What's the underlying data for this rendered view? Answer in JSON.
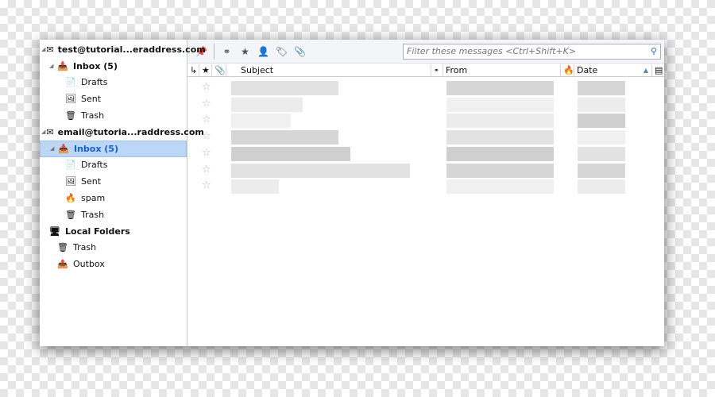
{
  "folders": [
    {
      "label": "test@tutorial...eraddress.com",
      "type": "account",
      "icon": "account-icon",
      "twisty": true
    },
    {
      "label": "Inbox (5)",
      "type": "inbox",
      "icon": "inbox-icon",
      "twisty": true,
      "indent": 1
    },
    {
      "label": "Drafts",
      "icon": "drafts-icon",
      "indent": 2
    },
    {
      "label": "Sent",
      "icon": "sent-icon",
      "indent": 2
    },
    {
      "label": "Trash",
      "icon": "trash-icon",
      "indent": 2
    },
    {
      "label": "email@tutoria...raddress.com",
      "type": "account",
      "icon": "account-icon",
      "twisty": true
    },
    {
      "label": "Inbox (5)",
      "type": "inbox",
      "icon": "inbox-icon",
      "twisty": true,
      "indent": 1,
      "selected": true
    },
    {
      "label": "Drafts",
      "icon": "drafts-icon",
      "indent": 2
    },
    {
      "label": "Sent",
      "icon": "sent-icon",
      "indent": 2
    },
    {
      "label": "spam",
      "icon": "spam-icon",
      "indent": 2
    },
    {
      "label": "Trash",
      "icon": "trash-icon",
      "indent": 2
    },
    {
      "label": "Local Folders",
      "type": "account",
      "icon": "local-folders-icon"
    },
    {
      "label": "Trash",
      "icon": "trash-icon",
      "indent": 1
    },
    {
      "label": "Outbox",
      "icon": "outbox-icon",
      "indent": 1
    }
  ],
  "toolbar": {
    "filter_placeholder": "Filter these messages <Ctrl+Shift+K>"
  },
  "columns": {
    "subject": "Subject",
    "from": "From",
    "date": "Date"
  },
  "message_count_rows": 7,
  "colors": {
    "selection": "#bcd6f5",
    "selected_text": "#1560d0"
  }
}
